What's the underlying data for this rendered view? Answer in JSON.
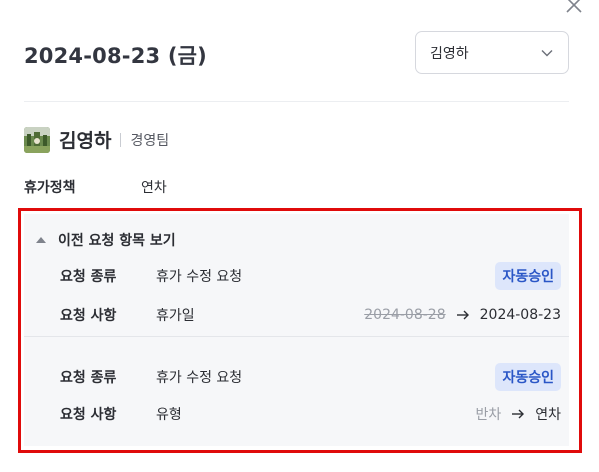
{
  "header": {
    "date": "2024-08-23 (금)",
    "user_select_value": "김영하"
  },
  "profile": {
    "name": "김영하",
    "team": "경영팀"
  },
  "policy": {
    "label": "휴가정책",
    "value": "연차"
  },
  "history": {
    "toggle_label": "이전 요청 항목 보기",
    "groups": [
      {
        "type_label": "요청 종류",
        "type_value": "휴가 수정 요청",
        "badge": "자동승인",
        "detail_label": "요청 사항",
        "detail_value": "휴가일",
        "old": "2024-08-28",
        "new": "2024-08-23"
      },
      {
        "type_label": "요청 종류",
        "type_value": "휴가 수정 요청",
        "badge": "자동승인",
        "detail_label": "요청 사항",
        "detail_value": "유형",
        "old": "반차",
        "new": "연차"
      }
    ]
  },
  "colors": {
    "highlight_border": "#e00b0b",
    "badge_bg": "#dde6fb",
    "badge_text": "#2a56c6"
  },
  "icons": {
    "close": "close-icon",
    "dropdown": "chevron-down-icon",
    "collapse": "triangle-up-icon",
    "arrow": "arrow-right-icon"
  }
}
